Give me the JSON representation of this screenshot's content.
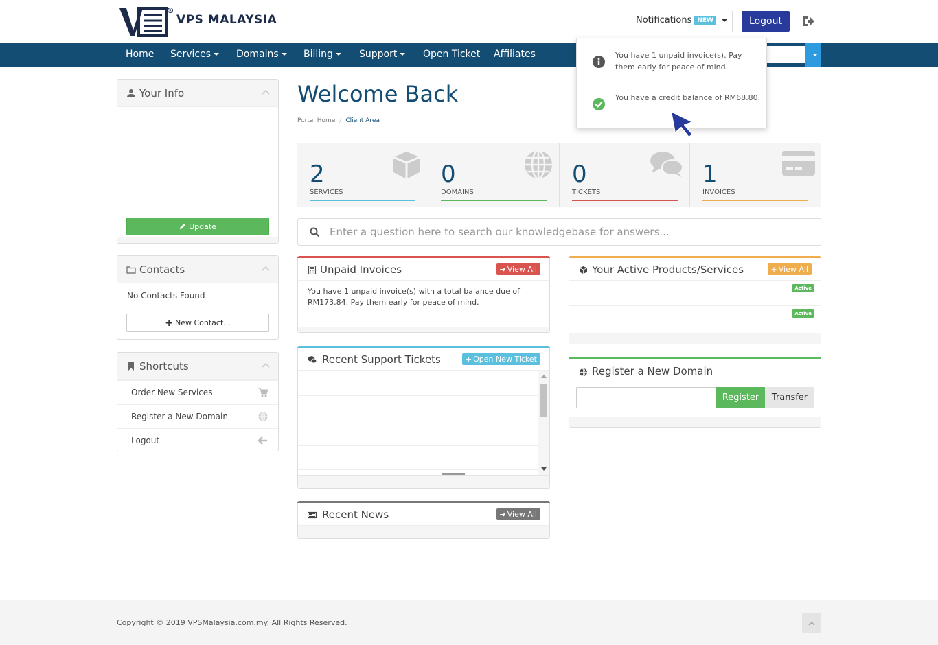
{
  "brand": {
    "name": "VPS MALAYSIA"
  },
  "header": {
    "notifications_label": "Notifications",
    "notifications_badge": "NEW",
    "logout_label": "Logout"
  },
  "nav": {
    "items": [
      {
        "label": "Home",
        "dropdown": false
      },
      {
        "label": "Services",
        "dropdown": true
      },
      {
        "label": "Domains",
        "dropdown": true
      },
      {
        "label": "Billing",
        "dropdown": true
      },
      {
        "label": "Support",
        "dropdown": true
      },
      {
        "label": "Open Ticket",
        "dropdown": false
      },
      {
        "label": "Affiliates",
        "dropdown": false
      }
    ]
  },
  "popover": {
    "items": [
      {
        "icon": "info-icon",
        "text": "You have 1 unpaid invoice(s). Pay them early for peace of mind."
      },
      {
        "icon": "check-circle-icon",
        "text": "You have a credit balance of RM68.80."
      }
    ]
  },
  "sidebar": {
    "your_info": {
      "title": "Your Info",
      "update_label": "Update"
    },
    "contacts": {
      "title": "Contacts",
      "empty_text": "No Contacts Found",
      "new_contact_label": "New Contact..."
    },
    "shortcuts": {
      "title": "Shortcuts",
      "items": [
        {
          "label": "Order New Services",
          "icon": "cart-icon"
        },
        {
          "label": "Register a New Domain",
          "icon": "globe-icon"
        },
        {
          "label": "Logout",
          "icon": "arrow-left-icon"
        }
      ]
    }
  },
  "main": {
    "title": "Welcome Back",
    "breadcrumb": [
      "Portal Home",
      "Client Area"
    ],
    "stats": [
      {
        "value": "2",
        "label": "SERVICES",
        "color": "#5bc0de",
        "icon": "cube-icon"
      },
      {
        "value": "0",
        "label": "DOMAINS",
        "color": "#5cb85c",
        "icon": "globe-icon"
      },
      {
        "value": "0",
        "label": "TICKETS",
        "color": "#d9534f",
        "icon": "comments-icon"
      },
      {
        "value": "1",
        "label": "INVOICES",
        "color": "#f0ad4e",
        "icon": "credit-card-icon"
      }
    ],
    "kb_search_placeholder": "Enter a question here to search our knowledgebase for answers...",
    "unpaid_invoices": {
      "title": "Unpaid Invoices",
      "button": "View All",
      "text": "You have 1 unpaid invoice(s) with a total balance due of RM173.84. Pay them early for peace of mind.",
      "accent": "#d9534f"
    },
    "active_products": {
      "title": "Your Active Products/Services",
      "button": "View All",
      "status": [
        "Active",
        "Active"
      ],
      "accent": "#f0ad4e"
    },
    "support_tickets": {
      "title": "Recent Support Tickets",
      "button": "Open New Ticket",
      "accent": "#5bc0de"
    },
    "register_domain": {
      "title": "Register a New Domain",
      "register_label": "Register",
      "transfer_label": "Transfer",
      "accent": "#5cb85c"
    },
    "recent_news": {
      "title": "Recent News",
      "button": "View All",
      "accent": "#777777"
    }
  },
  "footer": {
    "copyright": "Copyright © 2019 VPSMalaysia.com.my. All Rights Reserved."
  }
}
